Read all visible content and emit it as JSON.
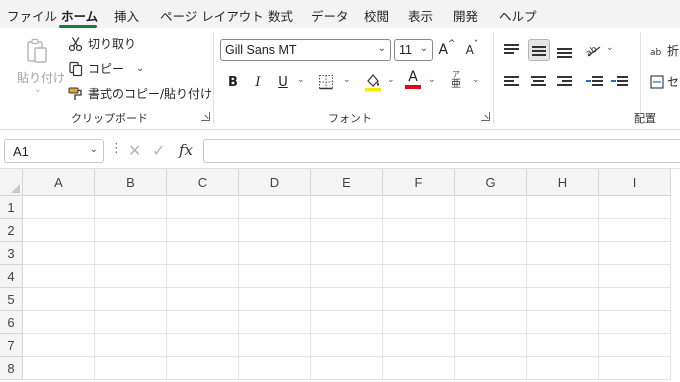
{
  "tabs": [
    "ファイル",
    "ホーム",
    "挿入",
    "ページ レイアウト",
    "数式",
    "データ",
    "校閲",
    "表示",
    "開発",
    "ヘルプ"
  ],
  "active_tab": "ホーム",
  "clipboard": {
    "paste": "貼り付け",
    "cut": "切り取り",
    "copy": "コピー",
    "format_painter": "書式のコピー/貼り付け",
    "label": "クリップボード"
  },
  "font": {
    "name": "Gill Sans MT",
    "size": "11",
    "grow": "A",
    "shrink": "A",
    "bold": "B",
    "italic": "I",
    "underline": "U",
    "font_color_letter": "A",
    "phonetic_top": "ア",
    "phonetic_bottom": "亜",
    "label": "フォント",
    "fill_color": "#ffe600",
    "font_color": "#e0001b"
  },
  "alignment": {
    "wrap_label": "折",
    "merge_label": "セ",
    "label": "配置"
  },
  "formula_bar": {
    "name_box": "A1",
    "fx": "fx",
    "cancel": "✕",
    "enter": "✓",
    "formula": ""
  },
  "grid": {
    "columns": [
      "A",
      "B",
      "C",
      "D",
      "E",
      "F",
      "G",
      "H",
      "I"
    ],
    "rows": [
      "1",
      "2",
      "3",
      "4",
      "5",
      "6",
      "7",
      "8"
    ]
  },
  "colors": {
    "accent": "#107c41",
    "tab_bar": "#f3f3f3",
    "header_bg": "#f5f5f5"
  }
}
